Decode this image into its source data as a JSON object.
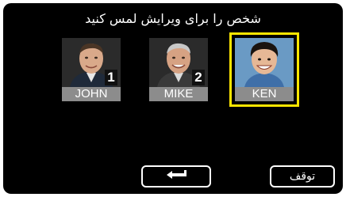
{
  "screen": {
    "title": "شخص را برای ویرایش لمس کنید"
  },
  "people": [
    {
      "name": "JOHN",
      "number": "1",
      "selected": false
    },
    {
      "name": "MIKE",
      "number": "2",
      "selected": false
    },
    {
      "name": "KEN",
      "number": "",
      "selected": true
    }
  ],
  "buttons": {
    "back_icon": "return-arrow-icon",
    "stop_label": "توقف"
  },
  "colors": {
    "background": "#000000",
    "selection": "#ffe600",
    "name_label": "#8c8c8c"
  }
}
